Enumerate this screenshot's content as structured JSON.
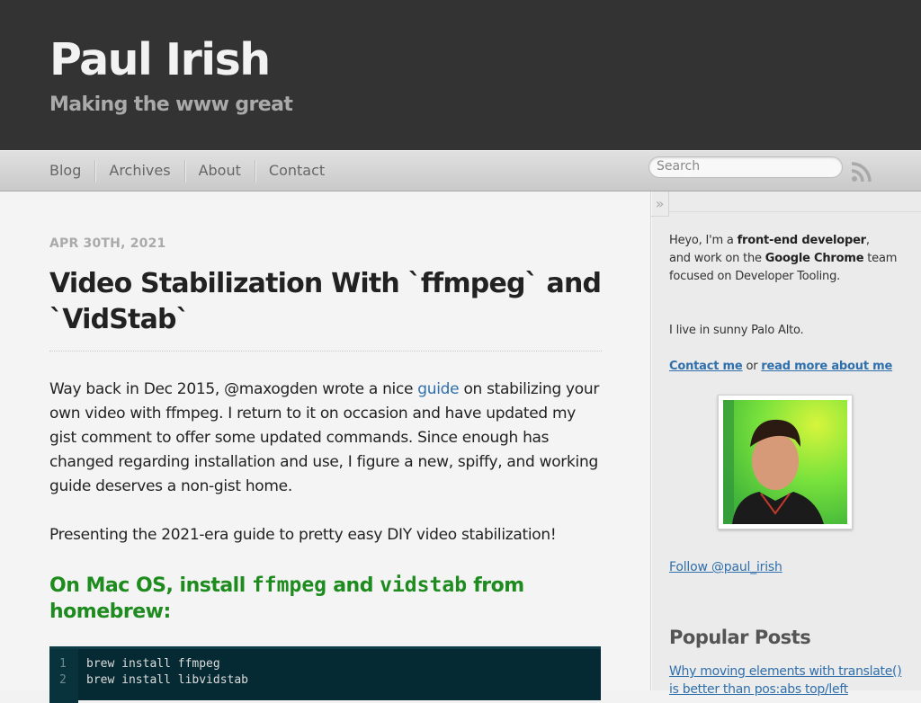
{
  "header": {
    "title": "Paul Irish",
    "subtitle": "Making the www great"
  },
  "nav": {
    "items": [
      "Blog",
      "Archives",
      "About",
      "Contact"
    ],
    "search_placeholder": "Search",
    "rss_icon": "rss-icon"
  },
  "post": {
    "date": "APR 30TH, 2021",
    "title": "Video Stabilization With `ffmpeg` and `VidStab`",
    "p1_before_link": "Way back in Dec 2015, @maxogden wrote a nice ",
    "p1_link": "guide",
    "p1_after_link": " on stabilizing your own video with ffmpeg. I return to it on occasion and have updated my gist comment to offer some updated commands. Since enough has changed regarding installation and use, I figure a new, spiffy, and working guide deserves a non-gist home.",
    "p2": "Presenting the 2021-era guide to pretty easy DIY video stabilization!",
    "heading_part1": "On Mac OS, install ",
    "heading_code1": "ffmpeg",
    "heading_part2": " and ",
    "heading_code2": "vidstab",
    "heading_part3": " from homebrew:",
    "code_lines": [
      {
        "num": "1",
        "text": "brew install ffmpeg"
      },
      {
        "num": "2",
        "text": "brew install libvidstab"
      }
    ]
  },
  "sidebar": {
    "collapse_label": "»",
    "intro_1": "Heyo, I'm a ",
    "intro_bold_1": "front-end developer",
    "intro_2": ",",
    "intro_3": "and work on the ",
    "intro_bold_2": "Google Chrome",
    "intro_4": " team",
    "intro_5": "focused on Developer Tooling.",
    "location": "I live in sunny Palo Alto.",
    "contact_link": "Contact me",
    "contact_or": " or ",
    "about_link": "read more about me",
    "follow_link": "Follow @paul_irish",
    "popular_heading": "Popular Posts",
    "popular_link_1": "Why moving elements with translate() is better than pos:abs top/left"
  },
  "colors": {
    "header_bg": "#333333",
    "link": "#2f6fab",
    "heading_green": "#1e8b1e",
    "code_bg": "#062a33"
  }
}
